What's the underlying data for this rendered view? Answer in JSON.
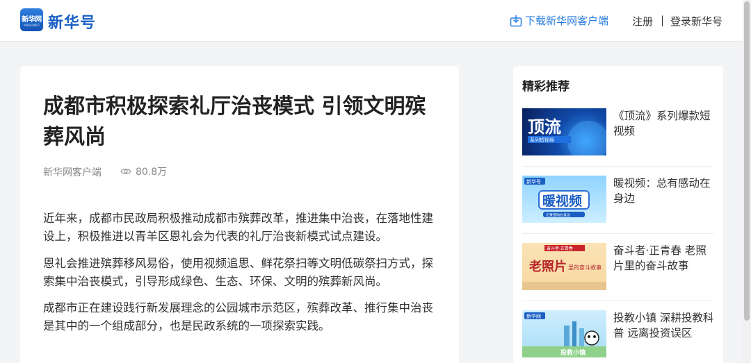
{
  "header": {
    "logo_badge_text": "新华网",
    "logo_badge_sub": "XINHUANET",
    "logo_text": "新华号",
    "download_label": "下载新华网客户端",
    "register_label": "注册",
    "separator": "|",
    "login_label": "登录新华号",
    "accent_color": "#2a7de1",
    "icons": {
      "download": "download-icon"
    }
  },
  "article": {
    "title": "成都市积极探索礼厅治丧模式 引领文明殡葬风尚",
    "source": "新华网客户端",
    "views": "80.8万",
    "paragraphs": [
      "近年来，成都市民政局积极推动成都市殡葬改革，推进集中治丧，在落地性建设上，积极推进以青羊区恩礼会为代表的礼厅治丧新模式试点建设。",
      "恩礼会推进殡葬移风易俗，使用视频追思、鲜花祭扫等文明低碳祭扫方式，探索集中治丧模式，引导形成绿色、生态、环保、文明的殡葬新风尚。",
      "成都市正在建设践行新发展理念的公园城市示范区，殡葬改革、推行集中治丧是其中的一个组成部分，也是民政系统的一项探索实践。"
    ],
    "icons": {
      "views": "eye-icon"
    }
  },
  "sidebar": {
    "title": "精彩推荐",
    "items": [
      {
        "text": "《顶流》系列爆款短视频",
        "thumb_title": "顶流",
        "thumb_sub": "系列短视频"
      },
      {
        "text": "暖视频：总有感动在身边",
        "thumb_title": "暖视频",
        "thumb_badge": "新华号",
        "thumb_sub": "记录感动在身边"
      },
      {
        "text": "奋斗者·正青春 老照片里的奋斗故事",
        "thumb_title": "老照片",
        "thumb_sub": "里的奋斗故事",
        "thumb_top": "奋斗者·正青春"
      },
      {
        "text": "投教小镇 深耕投教科普 远离投资误区",
        "thumb_title": "投教小镇",
        "thumb_badge": "新华网"
      }
    ]
  }
}
